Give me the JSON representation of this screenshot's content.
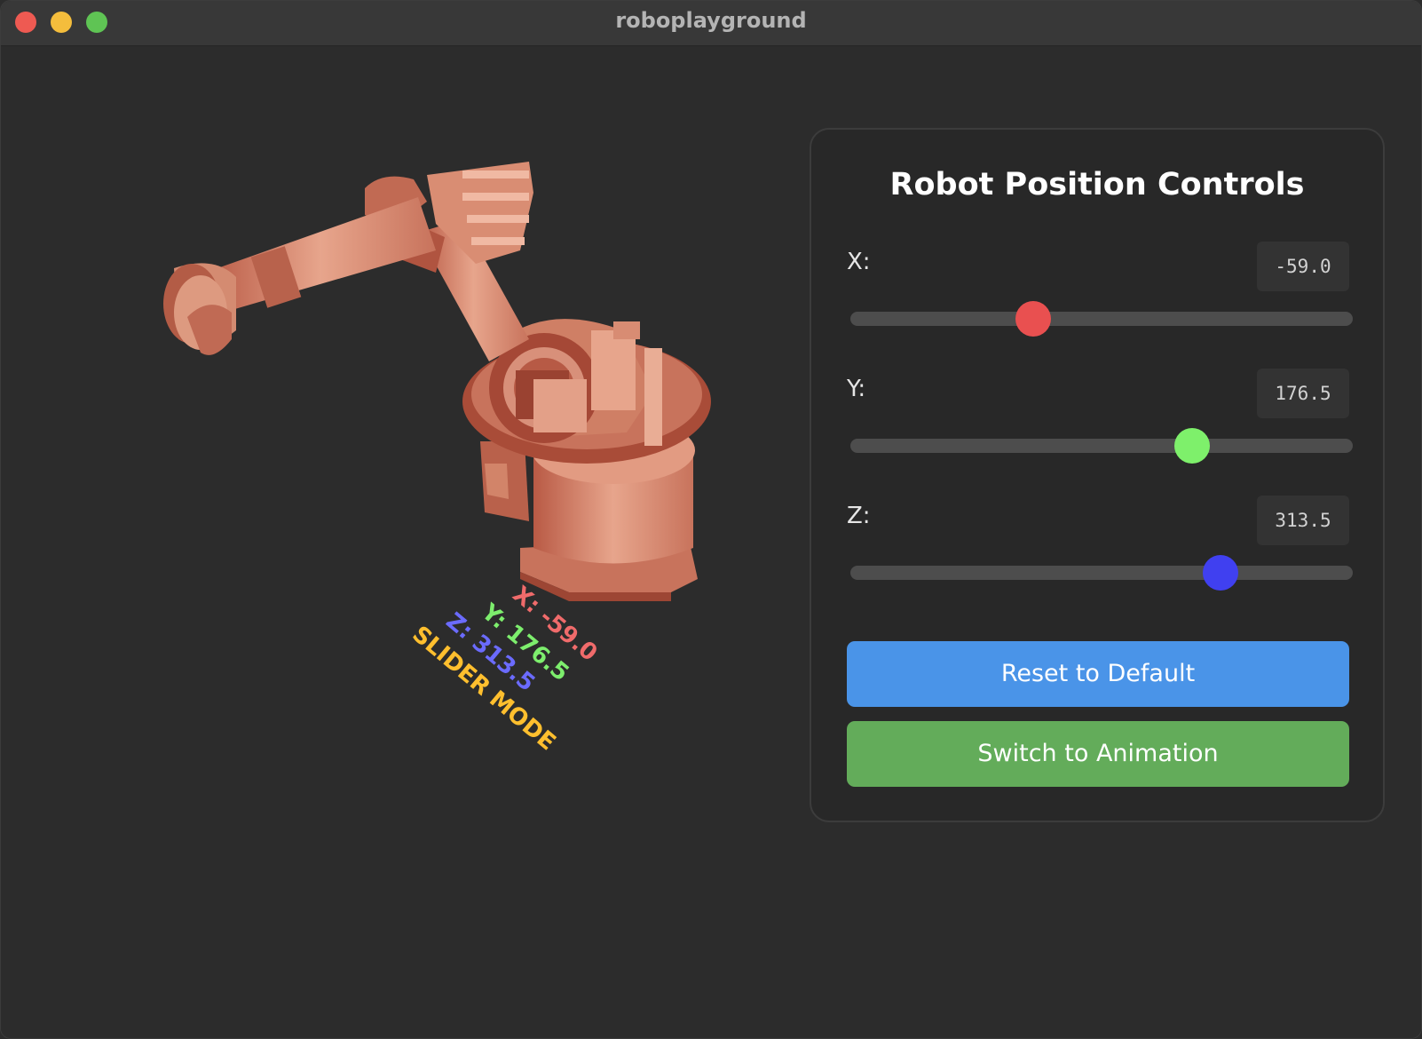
{
  "window": {
    "title": "roboplayground"
  },
  "viewport": {
    "robot_color": "#d9836a",
    "axis_label_colors": {
      "x": "#f06b6b",
      "y": "#7dee6d",
      "z": "#6b6bff",
      "mode": "#ffbf2e"
    }
  },
  "panel": {
    "title": "Robot Position Controls",
    "sliders": [
      {
        "label": "X:",
        "value": "-59.0",
        "fraction": 0.364,
        "color": "#e95050"
      },
      {
        "label": "Y:",
        "value": "176.5",
        "fraction": 0.68,
        "color": "#7ef06b"
      },
      {
        "label": "Z:",
        "value": "313.5",
        "fraction": 0.737,
        "color": "#4040f0"
      }
    ],
    "reset_label": "Reset to Default",
    "animation_label": "Switch to Animation",
    "colors": {
      "reset": "#4a94e8",
      "animation": "#63ac5a"
    }
  }
}
